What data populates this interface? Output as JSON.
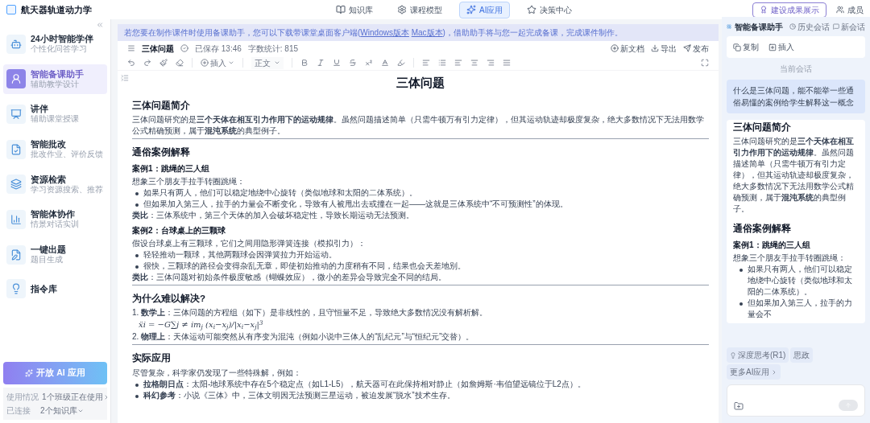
{
  "app": {
    "title": "航天器轨道动力学"
  },
  "nav": [
    {
      "label": "知识库",
      "selected": false
    },
    {
      "label": "课程模型",
      "selected": false
    },
    {
      "label": "AI应用",
      "selected": true
    },
    {
      "label": "决策中心",
      "selected": false
    }
  ],
  "header_actions": {
    "showcase": "建设成果展示",
    "member": "成员"
  },
  "sidebar": {
    "items": [
      {
        "title": "24小时智能学伴",
        "subtitle": "个性化问答学习",
        "selected": false
      },
      {
        "title": "智能备课助手",
        "subtitle": "辅助教学设计",
        "selected": true
      },
      {
        "title": "讲伴",
        "subtitle": "辅助课堂授课",
        "selected": false
      },
      {
        "title": "智能批改",
        "subtitle": "批改作业、评价反馈",
        "selected": false
      },
      {
        "title": "资源检索",
        "subtitle": "学习资源搜索、推荐",
        "selected": false
      },
      {
        "title": "智能体协作",
        "subtitle": "情景对话实训",
        "selected": false
      },
      {
        "title": "一键出题",
        "subtitle": "题目生成",
        "selected": false
      },
      {
        "title": "指令库",
        "selected": false
      }
    ],
    "open_button": "开放 AI 应用",
    "usage": {
      "label": "使用情况",
      "value": "1个班级正在使用"
    },
    "connected": {
      "label": "已连接",
      "value": "2个知识库"
    }
  },
  "banner": {
    "before": "若您要在制作课件时使用备课助手，您可以下载带课堂桌面客户端(",
    "link1": "Windows版本",
    "link2": "Mac版本",
    "after": ")，借助助手将与您一起完成备课，完成课件制作。"
  },
  "document": {
    "name": "三体问题",
    "saved": "已保存 13:46",
    "word_count": "字数统计: 815",
    "actions": [
      "新文档",
      "导出",
      "发布"
    ],
    "toolbar": {
      "insert": "插入",
      "style": "正文"
    },
    "blocks": [
      {
        "kind": "title",
        "text": "三体问题"
      },
      {
        "kind": "h2",
        "text": "三体问题简介"
      },
      {
        "kind": "p",
        "text": "三体问题研究的是**三个天体在相互引力作用下的运动规律**。虽然问题描述简单（只需牛顿万有引力定律），但其运动轨迹却极度复杂，绝大多数情况下无法用数学公式精确预测，属于**混沌系统**的典型例子。",
        "rule": true
      },
      {
        "kind": "h2",
        "text": "通俗案例解释"
      },
      {
        "kind": "h3",
        "text": "案例1：跳绳的三人组"
      },
      {
        "kind": "p",
        "text": "想象三个朋友手拉手转圈跳绳："
      },
      {
        "kind": "li",
        "text": "如果只有两人，他们可以稳定地绕中心旋转（类似地球和太阳的二体系统）。"
      },
      {
        "kind": "li",
        "text": "但如果加入第三人，拉手的力量会不断变化，导致有人被甩出去或撞在一起——这就是三体系统中“不可预测性”的体现。"
      },
      {
        "kind": "p",
        "text": "**类比**：三体系统中，第三个天体的加入会破坏稳定性，导致长期运动无法预测。"
      },
      {
        "kind": "h3",
        "text": "案例2：台球桌上的三颗球"
      },
      {
        "kind": "p",
        "text": "假设台球桌上有三颗球，它们之间用隐形弹簧连接（模拟引力）："
      },
      {
        "kind": "li",
        "text": "轻轻推动一颗球，其他两颗球会因弹簧拉力开始运动。"
      },
      {
        "kind": "li",
        "text": "很快，三颗球的路径会变得杂乱无章，即使初始推动的力度稍有不同，结果也会天差地别。"
      },
      {
        "kind": "p",
        "text": "**类比**：三体问题对初始条件极度敏感（蝴蝶效应），微小的差异会导致完全不同的结局。",
        "rule": true
      },
      {
        "kind": "h2",
        "text": "为什么难以解决?"
      },
      {
        "kind": "p",
        "text": "1. **数学上**：三体问题的方程组（如下）是非线性的，且守恒量不足，导致绝大多数情况没有解析解。"
      },
      {
        "kind": "formula",
        "text": "ẍi = −G∑j ≠ im$_{j}$ (x$_{i}$−x$_{j}$)/|x$_{i}$−x$_{j}$|$^{3}$"
      },
      {
        "kind": "p",
        "text": "2. **物理上**：天体运动可能突然从有序变为混沌（例如小说中三体人的“乱纪元”与“恒纪元”交替）。",
        "rule": true
      },
      {
        "kind": "h2",
        "text": "实际应用"
      },
      {
        "kind": "p",
        "text": "尽管复杂，科学家仍发现了一些特殊解，例如："
      },
      {
        "kind": "li",
        "text": "**拉格朗日点**：太阳-地球系统中存在5个稳定点（如L1-L5），航天器可在此保持相对静止（如詹姆斯·韦伯望远镜位于L2点）。"
      },
      {
        "kind": "li",
        "text": "**科幻参考**：小说《三体》中，三体文明因无法预测三星运动，被迫发展“脱水”技术生存。"
      }
    ]
  },
  "assistant": {
    "title": "智能备课助手",
    "history": "历史会话",
    "new": "新会话",
    "copy": "复制",
    "insert": "插入",
    "session_label": "当前会话",
    "question": "什么是三体问题，能不能举一些通俗易懂的案例给学生解释这一概念",
    "answer": [
      {
        "kind": "h2",
        "text": "三体问题简介"
      },
      {
        "kind": "p",
        "text": "三体问题研究的是**三个天体在相互引力作用下的运动规律**。虽然问题描述简单（只需牛顿万有引力定律），但其运动轨迹却极度复杂，绝大多数情况下无法用数学公式精确预测，属于**混沌系统**的典型例子。"
      },
      {
        "kind": "h2",
        "text": "通俗案例解释"
      },
      {
        "kind": "h3",
        "text": "案例1：跳绳的三人组"
      },
      {
        "kind": "p",
        "text": "想象三个朋友手拉手转圈跳绳："
      },
      {
        "kind": "li",
        "text": "如果只有两人，他们可以稳定地绕中心旋转（类似地球和太阳的二体系统）。"
      },
      {
        "kind": "li",
        "text": "但如果加入第三人，拉手的力量会不"
      }
    ],
    "chips": [
      "深度思考(R1)",
      "思政",
      "更多AI应用"
    ]
  }
}
